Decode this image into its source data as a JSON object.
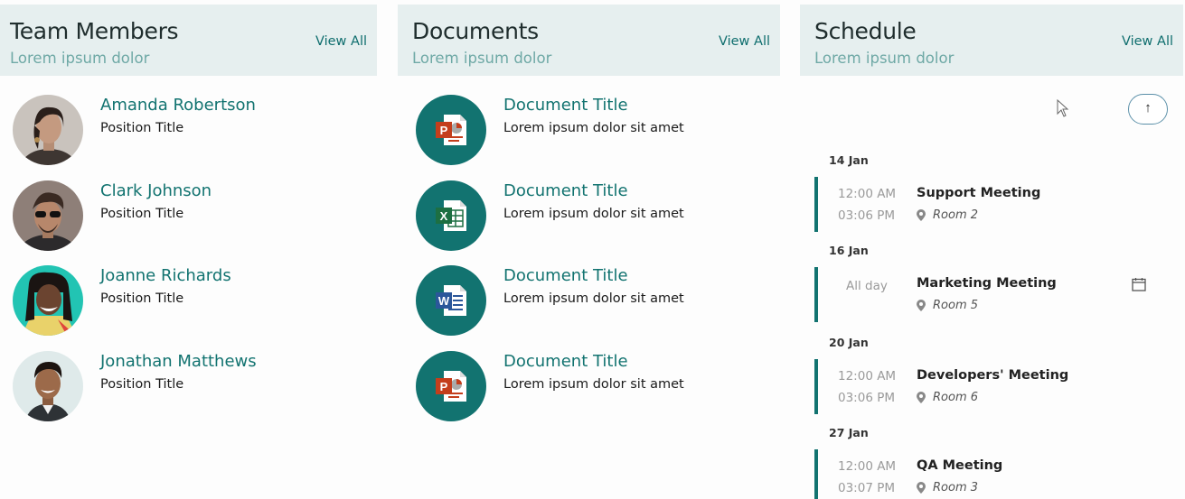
{
  "team": {
    "title": "Team Members",
    "subtitle": "Lorem ipsum dolor",
    "view_all": "View All",
    "members": [
      {
        "name": "Amanda Robertson",
        "position": "Position Title"
      },
      {
        "name": "Clark Johnson",
        "position": "Position Title"
      },
      {
        "name": "Joanne Richards",
        "position": "Position Title"
      },
      {
        "name": "Jonathan Matthews",
        "position": "Position Title"
      }
    ]
  },
  "documents": {
    "title": "Documents",
    "subtitle": "Lorem ipsum dolor",
    "view_all": "View All",
    "items": [
      {
        "title": "Document Title",
        "desc": "Lorem ipsum dolor sit amet",
        "icon": "powerpoint-icon"
      },
      {
        "title": "Document Title",
        "desc": "Lorem ipsum dolor sit amet",
        "icon": "excel-icon"
      },
      {
        "title": "Document Title",
        "desc": "Lorem ipsum dolor sit amet",
        "icon": "word-icon"
      },
      {
        "title": "Document Title",
        "desc": "Lorem ipsum dolor sit amet",
        "icon": "powerpoint-icon"
      }
    ]
  },
  "schedule": {
    "title": "Schedule",
    "subtitle": "Lorem ipsum dolor",
    "view_all": "View All",
    "scroll_up_icon": "arrow-up-icon",
    "groups": [
      {
        "date": "14 Jan",
        "event": {
          "start": "12:00 AM",
          "end": "03:06 PM",
          "title": "Support Meeting",
          "location": "Room 2"
        }
      },
      {
        "date": "16 Jan",
        "event": {
          "all_day": "All day",
          "title": "Marketing Meeting",
          "location": "Room 5"
        }
      },
      {
        "date": "20 Jan",
        "event": {
          "start": "12:00 AM",
          "end": "03:06 PM",
          "title": "Developers' Meeting",
          "location": "Room 6"
        }
      },
      {
        "date": "27 Jan",
        "event": {
          "start": "12:00 AM",
          "end": "03:07 PM",
          "title": "QA Meeting",
          "location": "Room 3"
        }
      }
    ]
  },
  "colors": {
    "accent": "#127370",
    "header_bg": "#e6efef",
    "subtitle": "#6fa9a6",
    "powerpoint": "#c43e1c",
    "excel": "#1d6f42",
    "word": "#2b579a"
  }
}
